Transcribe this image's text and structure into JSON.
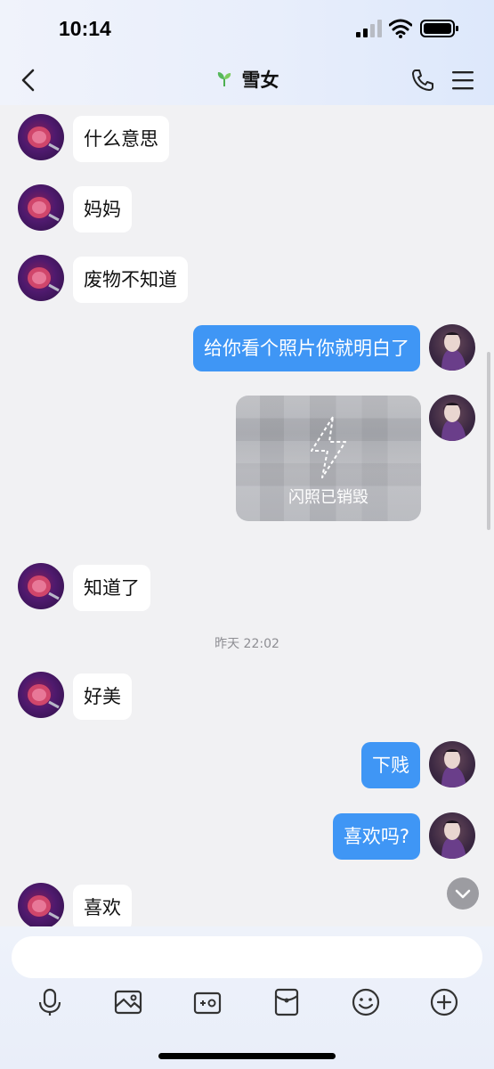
{
  "status_bar": {
    "time": "10:14"
  },
  "header": {
    "title": "雪女"
  },
  "messages": [
    {
      "side": "in",
      "text": "什么意思"
    },
    {
      "side": "in",
      "text": "妈妈"
    },
    {
      "side": "in",
      "text": "废物不知道"
    },
    {
      "side": "out",
      "text": "给你看个照片你就明白了"
    },
    {
      "side": "out",
      "type": "flash_photo",
      "text": "闪照已销毁"
    },
    {
      "side": "in",
      "text": "知道了"
    },
    {
      "type": "timestamp",
      "text": "昨天 22:02"
    },
    {
      "side": "in",
      "text": "好美"
    },
    {
      "side": "out",
      "text": "下贱"
    },
    {
      "side": "out",
      "text": "喜欢吗?"
    },
    {
      "side": "in",
      "text": "喜欢"
    }
  ],
  "input": {
    "placeholder": ""
  },
  "toolbar": [
    "microphone-icon",
    "image-icon",
    "camera-icon",
    "red-packet-icon",
    "emoji-icon",
    "plus-icon"
  ],
  "colors": {
    "outgoing_bubble": "#3f96f5",
    "incoming_bubble": "#ffffff",
    "background": "#f1f1f3"
  }
}
